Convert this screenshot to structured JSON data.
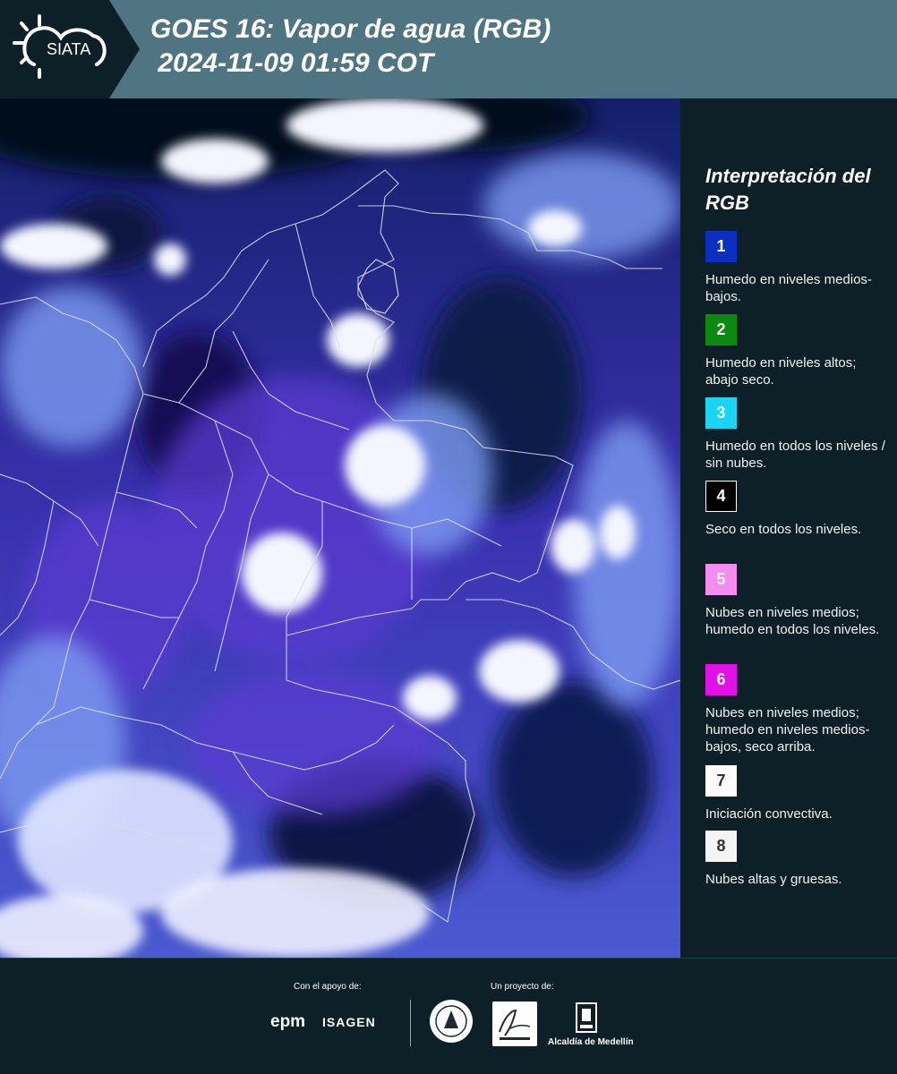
{
  "header": {
    "logo_text": "SIATA",
    "title": "GOES 16: Vapor de agua (RGB)\n 2024-11-09 01:59 COT"
  },
  "map": {
    "description_icon": "satellite-water-vapor-rgb-map",
    "border_color": "#d8dde8"
  },
  "legend": {
    "title": "Interpretación del RGB",
    "items": [
      {
        "number": "1",
        "color": "#0b2fc0",
        "text_color": "#ffffff",
        "text": "Humedo en niveles medios-bajos."
      },
      {
        "number": "2",
        "color": "#0a8a0e",
        "text_color": "#ffffff",
        "text": "Humedo en niveles altos; abajo seco."
      },
      {
        "number": "3",
        "color": "#19d4f2",
        "text_color": "#ffffff",
        "text": "Humedo en todos los niveles / sin nubes."
      },
      {
        "number": "4",
        "color": "#000000",
        "text_color": "#ffffff",
        "text": "Seco en todos los niveles."
      },
      {
        "number": "5",
        "color": "#f58df0",
        "text_color": "#ffffff",
        "text": "Nubes en niveles medios; humedo en todos los niveles."
      },
      {
        "number": "6",
        "color": "#e310e8",
        "text_color": "#ffffff",
        "text": "Nubes en niveles medios; humedo en niveles medios-bajos, seco arriba."
      },
      {
        "number": "7",
        "color": "#fbfbfb",
        "text_color": "#333333",
        "text": "Iniciación convectiva."
      },
      {
        "number": "8",
        "color": "#f4f4f4",
        "text_color": "#333333",
        "text": "Nubes altas y gruesas."
      }
    ]
  },
  "footer": {
    "support_label": "Con el apoyo de:",
    "project_label": "Un proyecto de:",
    "epm": "epm",
    "isagen": "ISAGEN",
    "alcaldia": "Alcaldía de Medellín"
  }
}
